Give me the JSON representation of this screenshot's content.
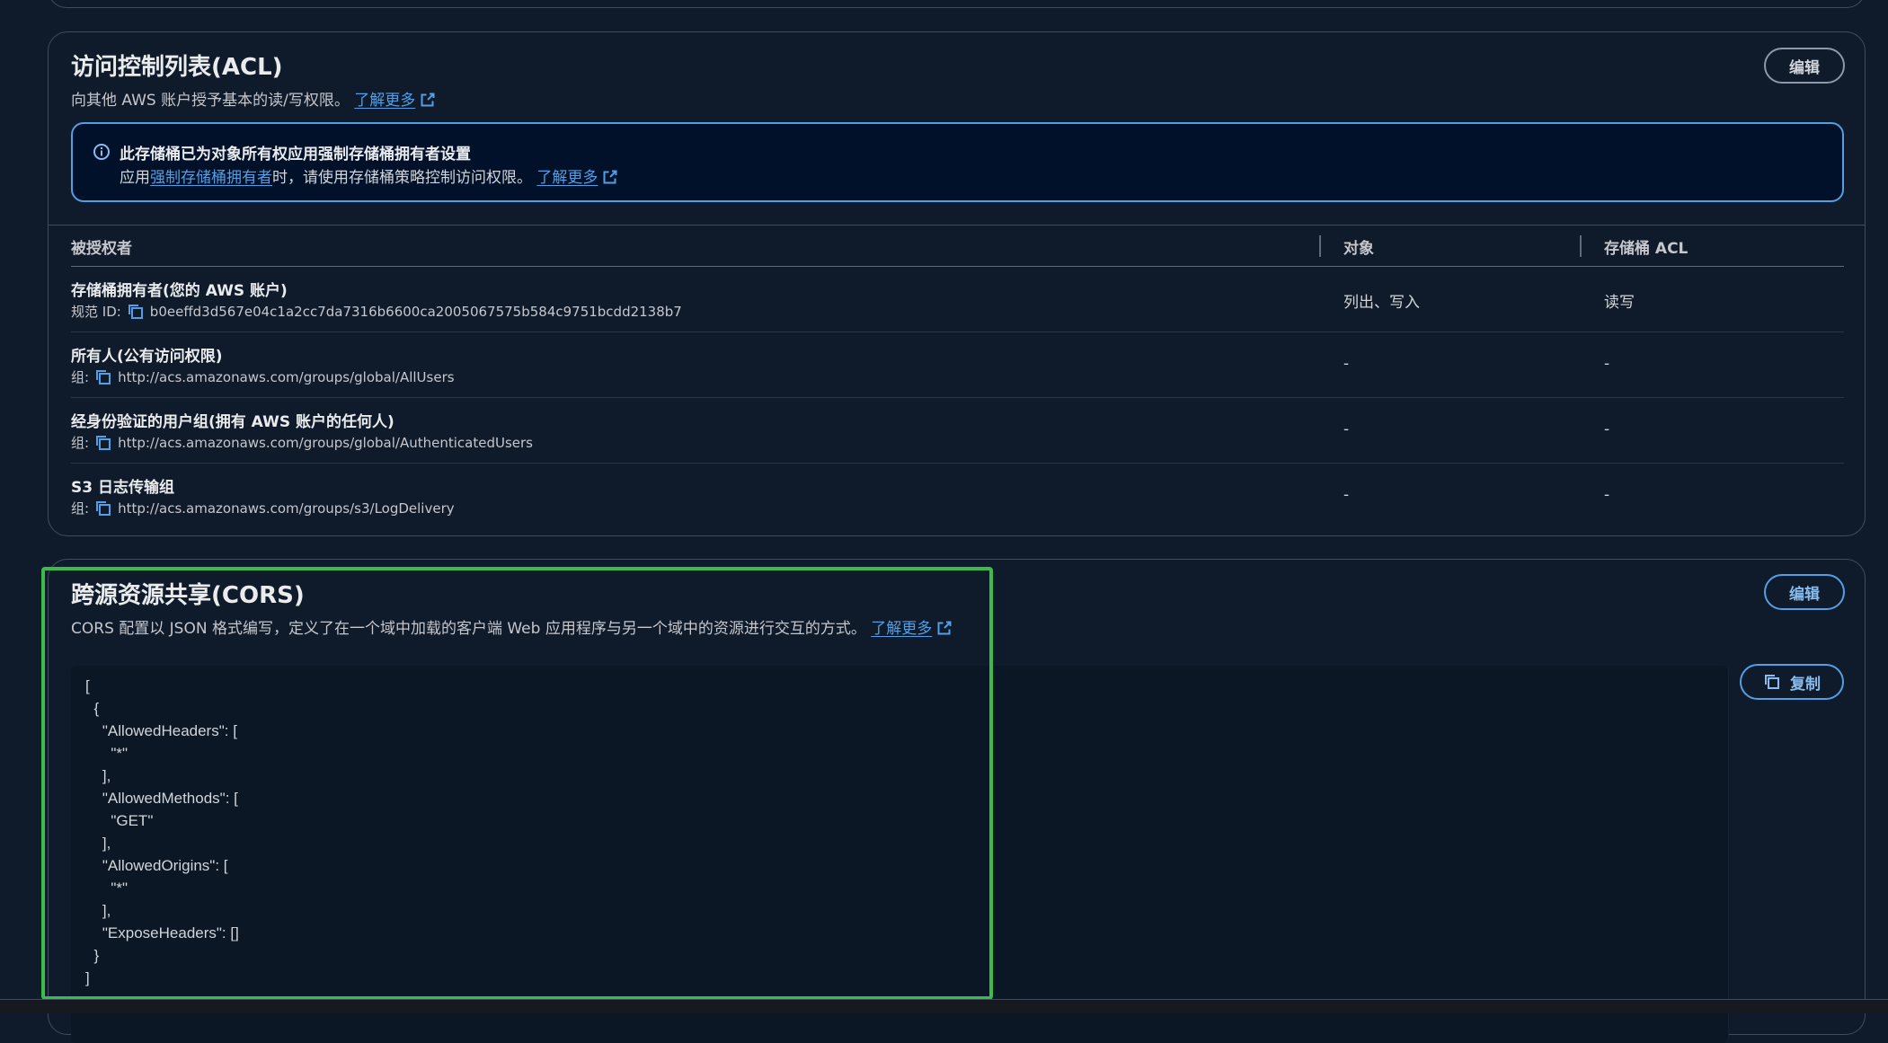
{
  "acl": {
    "title": "访问控制列表(ACL)",
    "description": "向其他 AWS 账户授予基本的读/写权限。",
    "learn_more": "了解更多",
    "edit_label": "编辑",
    "alert": {
      "title": "此存储桶已为对象所有权应用强制存储桶拥有者设置",
      "body_prefix": "应用",
      "body_link": "强制存储桶拥有者",
      "body_suffix": "时，请使用存储桶策略控制访问权限。",
      "learn_more": "了解更多"
    },
    "columns": [
      "被授权者",
      "对象",
      "存储桶 ACL"
    ],
    "rows": [
      {
        "grantee": "存储桶拥有者(您的 AWS 账户)",
        "sub_label": "规范 ID:",
        "sub_value": "b0eeffd3d567e04c1a2cc7da7316b6600ca2005067575b584c9751bcdd2138b7",
        "objects": "列出、写入",
        "bucket_acl": "读写"
      },
      {
        "grantee": "所有人(公有访问权限)",
        "sub_label": "组:",
        "sub_value": "http://acs.amazonaws.com/groups/global/AllUsers",
        "objects": "-",
        "bucket_acl": "-"
      },
      {
        "grantee": "经身份验证的用户组(拥有 AWS 账户的任何人)",
        "sub_label": "组:",
        "sub_value": "http://acs.amazonaws.com/groups/global/AuthenticatedUsers",
        "objects": "-",
        "bucket_acl": "-"
      },
      {
        "grantee": "S3 日志传输组",
        "sub_label": "组:",
        "sub_value": "http://acs.amazonaws.com/groups/s3/LogDelivery",
        "objects": "-",
        "bucket_acl": "-"
      }
    ]
  },
  "cors": {
    "title": "跨源资源共享(CORS)",
    "description": "CORS 配置以 JSON 格式编写，定义了在一个域中加载的客户端 Web 应用程序与另一个域中的资源进行交互的方式。",
    "learn_more": "了解更多",
    "edit_label": "编辑",
    "copy_label": "复制",
    "code": "[\n  {\n    \"AllowedHeaders\": [\n      \"*\"\n    ],\n    \"AllowedMethods\": [\n      \"GET\"\n    ],\n    \"AllowedOrigins\": [\n      \"*\"\n    ],\n    \"ExposeHeaders\": []\n  }\n]"
  },
  "colors": {
    "accent": "#539fe5",
    "highlight": "#3dba4e",
    "background": "#0f1b2a"
  }
}
